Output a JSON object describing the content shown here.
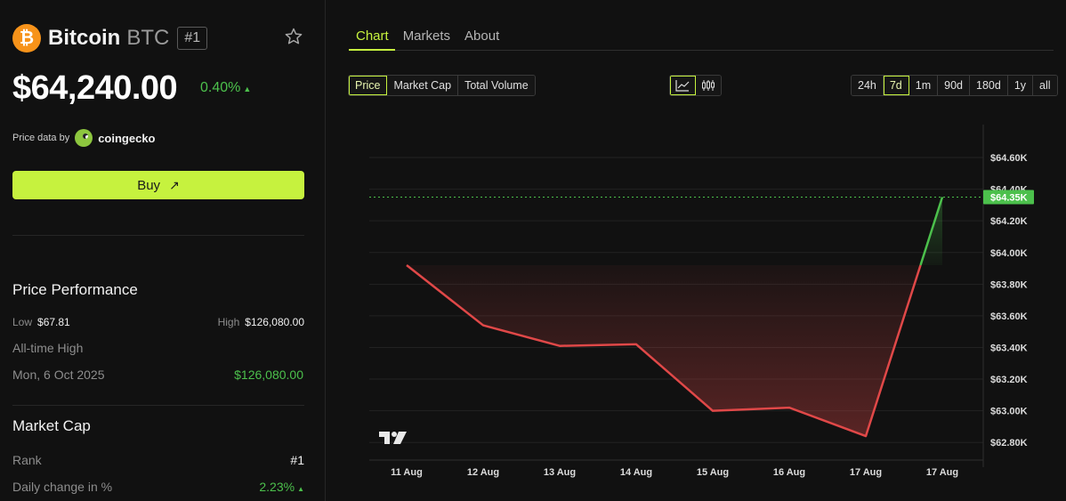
{
  "coin": {
    "logo_symbol": "₿",
    "name": "Bitcoin",
    "ticker": "BTC",
    "rank": "#1",
    "price": "$64,240.00",
    "change": "0.40%",
    "change_arrow": "▲",
    "price_data_by": "Price data by",
    "provider": "coingecko",
    "star_icon": "star-outline"
  },
  "buy": {
    "label": "Buy",
    "arrow": "↗"
  },
  "performance": {
    "title": "Price Performance",
    "low_label": "Low",
    "low_value": "$67.81",
    "high_label": "High",
    "high_value": "$126,080.00",
    "ath_label": "All-time High",
    "ath_date": "Mon, 6 Oct 2025",
    "ath_value": "$126,080.00"
  },
  "market_cap": {
    "title": "Market Cap",
    "rank_label": "Rank",
    "rank_value": "#1",
    "daily_label": "Daily change in %",
    "daily_value": "2.23%",
    "daily_arrow": "▲"
  },
  "tabs": [
    "Chart",
    "Markets",
    "About"
  ],
  "metric_options": [
    "Price",
    "Market Cap",
    "Total Volume"
  ],
  "range_options": [
    "24h",
    "7d",
    "1m",
    "90d",
    "180d",
    "1y",
    "all"
  ],
  "colors": {
    "accent": "#c6f23e",
    "up": "#4cc04c",
    "down": "#e04848",
    "btc": "#f7931a"
  },
  "chart_data": {
    "type": "line",
    "x": [
      "11 Aug",
      "12 Aug",
      "13 Aug",
      "14 Aug",
      "15 Aug",
      "16 Aug",
      "17 Aug",
      "17 Aug"
    ],
    "values": [
      63920,
      63540,
      63410,
      63420,
      63000,
      63020,
      62840,
      64350
    ],
    "baseline": 63920,
    "last_price_label": "$64.35K",
    "y_ticks": [
      "$64.60K",
      "$64.40K",
      "$64.20K",
      "$64.00K",
      "$63.80K",
      "$63.60K",
      "$63.40K",
      "$63.20K",
      "$63.00K",
      "$62.80K"
    ],
    "y_tick_values": [
      64600,
      64400,
      64200,
      64000,
      63800,
      63600,
      63400,
      63200,
      63000,
      62800
    ],
    "ylim": [
      62700,
      64780
    ],
    "grid": true,
    "watermark": "TV"
  }
}
